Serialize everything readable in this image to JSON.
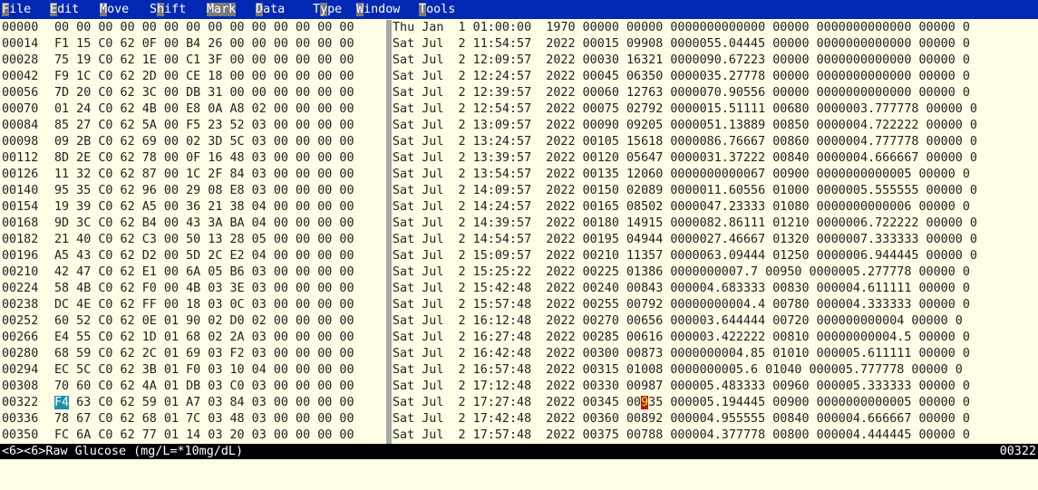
{
  "menu": {
    "items": [
      {
        "hot": "F",
        "rest": "ile"
      },
      {
        "hot": "E",
        "rest": "dit"
      },
      {
        "hot": "M",
        "rest": "ove"
      },
      {
        "hot": "Sh",
        "rest": "ift",
        "hot_index": 1,
        "text": "Shift"
      },
      {
        "hot": "Mark",
        "rest": ""
      },
      {
        "hot": "D",
        "rest": "ata"
      },
      {
        "hot": "T",
        "rest": "ype",
        "hot_index": 1,
        "text": "Type"
      },
      {
        "hot": "W",
        "rest": "indow"
      },
      {
        "hot": "T",
        "rest": "ools"
      }
    ]
  },
  "rows": [
    {
      "offset": "00000",
      "hex": "00 00 00 00 00 00 00 00 00 00 00 00 00 00",
      "date": "Thu Jan  1 01:00:00  1970 00000 00000 0000000000000 00000 0000000000000 00000 0"
    },
    {
      "offset": "00014",
      "hex": "F1 15 C0 62 0F 00 B4 26 00 00 00 00 00 00",
      "date": "Sat Jul  2 11:54:57  2022 00015 09908 0000055.04445 00000 0000000000000 00000 0"
    },
    {
      "offset": "00028",
      "hex": "75 19 C0 62 1E 00 C1 3F 00 00 00 00 00 00",
      "date": "Sat Jul  2 12:09:57  2022 00030 16321 0000090.67223 00000 0000000000000 00000 0"
    },
    {
      "offset": "00042",
      "hex": "F9 1C C0 62 2D 00 CE 18 00 00 00 00 00 00",
      "date": "Sat Jul  2 12:24:57  2022 00045 06350 0000035.27778 00000 0000000000000 00000 0"
    },
    {
      "offset": "00056",
      "hex": "7D 20 C0 62 3C 00 DB 31 00 00 00 00 00 00",
      "date": "Sat Jul  2 12:39:57  2022 00060 12763 0000070.90556 00000 0000000000000 00000 0"
    },
    {
      "offset": "00070",
      "hex": "01 24 C0 62 4B 00 E8 0A A8 02 00 00 00 00",
      "date": "Sat Jul  2 12:54:57  2022 00075 02792 0000015.51111 00680 0000003.777778 00000 0"
    },
    {
      "offset": "00084",
      "hex": "85 27 C0 62 5A 00 F5 23 52 03 00 00 00 00",
      "date": "Sat Jul  2 13:09:57  2022 00090 09205 0000051.13889 00850 0000004.722222 00000 0"
    },
    {
      "offset": "00098",
      "hex": "09 2B C0 62 69 00 02 3D 5C 03 00 00 00 00",
      "date": "Sat Jul  2 13:24:57  2022 00105 15618 0000086.76667 00860 0000004.777778 00000 0"
    },
    {
      "offset": "00112",
      "hex": "8D 2E C0 62 78 00 0F 16 48 03 00 00 00 00",
      "date": "Sat Jul  2 13:39:57  2022 00120 05647 0000031.37222 00840 0000004.666667 00000 0"
    },
    {
      "offset": "00126",
      "hex": "11 32 C0 62 87 00 1C 2F 84 03 00 00 00 00",
      "date": "Sat Jul  2 13:54:57  2022 00135 12060 0000000000067 00900 0000000000005 00000 0"
    },
    {
      "offset": "00140",
      "hex": "95 35 C0 62 96 00 29 08 E8 03 00 00 00 00",
      "date": "Sat Jul  2 14:09:57  2022 00150 02089 0000011.60556 01000 0000005.555555 00000 0"
    },
    {
      "offset": "00154",
      "hex": "19 39 C0 62 A5 00 36 21 38 04 00 00 00 00",
      "date": "Sat Jul  2 14:24:57  2022 00165 08502 0000047.23333 01080 0000000000006 00000 0"
    },
    {
      "offset": "00168",
      "hex": "9D 3C C0 62 B4 00 43 3A BA 04 00 00 00 00",
      "date": "Sat Jul  2 14:39:57  2022 00180 14915 0000082.86111 01210 0000006.722222 00000 0"
    },
    {
      "offset": "00182",
      "hex": "21 40 C0 62 C3 00 50 13 28 05 00 00 00 00",
      "date": "Sat Jul  2 14:54:57  2022 00195 04944 0000027.46667 01320 0000007.333333 00000 0"
    },
    {
      "offset": "00196",
      "hex": "A5 43 C0 62 D2 00 5D 2C E2 04 00 00 00 00",
      "date": "Sat Jul  2 15:09:57  2022 00210 11357 0000063.09444 01250 0000006.944445 00000 0"
    },
    {
      "offset": "00210",
      "hex": "42 47 C0 62 E1 00 6A 05 B6 03 00 00 00 00",
      "date": "Sat Jul  2 15:25:22  2022 00225 01386 0000000007.7 00950 0000005.277778 00000 0"
    },
    {
      "offset": "00224",
      "hex": "58 4B C0 62 F0 00 4B 03 3E 03 00 00 00 00",
      "date": "Sat Jul  2 15:42:48  2022 00240 00843 000004.683333 00830 000004.611111 00000 0"
    },
    {
      "offset": "00238",
      "hex": "DC 4E C0 62 FF 00 18 03 0C 03 00 00 00 00",
      "date": "Sat Jul  2 15:57:48  2022 00255 00792 00000000004.4 00780 000004.333333 00000 0"
    },
    {
      "offset": "00252",
      "hex": "60 52 C0 62 0E 01 90 02 D0 02 00 00 00 00",
      "date": "Sat Jul  2 16:12:48  2022 00270 00656 000003.644444 00720 000000000004 00000 0"
    },
    {
      "offset": "00266",
      "hex": "E4 55 C0 62 1D 01 68 02 2A 03 00 00 00 00",
      "date": "Sat Jul  2 16:27:48  2022 00285 00616 000003.422222 00810 00000000004.5 00000 0"
    },
    {
      "offset": "00280",
      "hex": "68 59 C0 62 2C 01 69 03 F2 03 00 00 00 00",
      "date": "Sat Jul  2 16:42:48  2022 00300 00873 0000000004.85 01010 000005.611111 00000 0"
    },
    {
      "offset": "00294",
      "hex": "EC 5C C0 62 3B 01 F0 03 10 04 00 00 00 00",
      "date": "Sat Jul  2 16:57:48  2022 00315 01008 0000000005.6 01040 000005.777778 00000 0"
    },
    {
      "offset": "00308",
      "hex": "70 60 C0 62 4A 01 DB 03 C0 03 00 00 00 00",
      "date": "Sat Jul  2 17:12:48  2022 00330 00987 000005.483333 00960 000005.333333 00000 0"
    },
    {
      "offset": "00322",
      "hex": "F4 63 C0 62 59 01 A7 03 84 03 00 00 00 00",
      "date": "Sat Jul  2 17:27:48  2022 00345 00935 000005.194445 00900 0000000000005 00000 0",
      "cursor": true
    },
    {
      "offset": "00336",
      "hex": "78 67 C0 62 68 01 7C 03 48 03 00 00 00 00",
      "date": "Sat Jul  2 17:42:48  2022 00360 00892 000004.955555 00840 000004.666667 00000 0"
    },
    {
      "offset": "00350",
      "hex": "FC 6A C0 62 77 01 14 03 20 03 00 00 00 00",
      "date": "Sat Jul  2 17:57:48  2022 00375 00788 000004.377778 00800 000004.444445 00000 0"
    }
  ],
  "cursor": {
    "hex_byte": "F4",
    "dec_char": "9"
  },
  "status": {
    "left": "<6><6>Raw Glucose (mg/L=*10mg/dL)",
    "right": "00322"
  },
  "colors": {
    "menubar_bg": "#0028b4",
    "hotkey_bg": "#7a7a7a",
    "page_bg": "#fffde6",
    "separator": "#a8a8a8",
    "cursor_hex_bg": "#1e90a8",
    "cursor_dec_bg": "#b01818",
    "status_bg": "#000000"
  }
}
